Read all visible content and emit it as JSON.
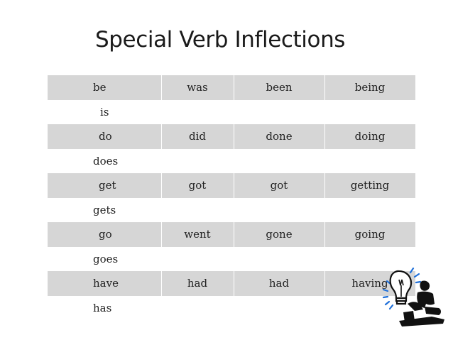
{
  "slide": {
    "title": "Special Verb Inflections"
  },
  "table": {
    "rows": [
      {
        "cells": [
          "be",
          "was",
          "been",
          "being"
        ],
        "shaded": true
      },
      {
        "cells": [
          "is",
          "",
          "",
          ""
        ],
        "shaded": false
      },
      {
        "cells": [
          "do",
          "did",
          "done",
          "doing"
        ],
        "shaded": true
      },
      {
        "cells": [
          "does",
          "",
          "",
          ""
        ],
        "shaded": false
      },
      {
        "cells": [
          "get",
          "got",
          "got",
          "getting"
        ],
        "shaded": true
      },
      {
        "cells": [
          "gets",
          "",
          "",
          ""
        ],
        "shaded": false
      },
      {
        "cells": [
          "go",
          "went",
          "gone",
          "going"
        ],
        "shaded": true
      },
      {
        "cells": [
          "goes",
          "",
          "",
          ""
        ],
        "shaded": false
      },
      {
        "cells": [
          "have",
          "had",
          "had",
          "having"
        ],
        "shaded": true
      },
      {
        "cells": [
          "has",
          "",
          "",
          ""
        ],
        "shaded": false
      }
    ]
  },
  "clipart": {
    "icon": "lightbulb-thinker-icon",
    "colors": {
      "bulb_outline": "#111111",
      "rays": "#1e6fd9",
      "figure": "#111111"
    }
  }
}
